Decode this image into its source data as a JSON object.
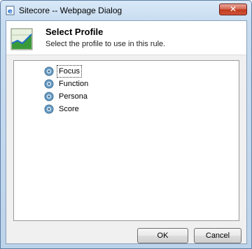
{
  "window": {
    "title": "Sitecore -- Webpage Dialog",
    "close_glyph": "✕"
  },
  "header": {
    "title": "Select Profile",
    "subtitle": "Select the profile to use in this rule."
  },
  "tree": {
    "items": [
      {
        "label": "Focus",
        "icon": "profile-node-icon",
        "selected": true
      },
      {
        "label": "Function",
        "icon": "profile-node-icon",
        "selected": false
      },
      {
        "label": "Persona",
        "icon": "profile-node-icon",
        "selected": false
      },
      {
        "label": "Score",
        "icon": "profile-node-icon",
        "selected": false
      }
    ]
  },
  "buttons": {
    "ok": "OK",
    "cancel": "Cancel"
  },
  "colors": {
    "titlebar": "#c8dcf0",
    "close": "#c0391e",
    "panel": "#f0f0f0"
  }
}
